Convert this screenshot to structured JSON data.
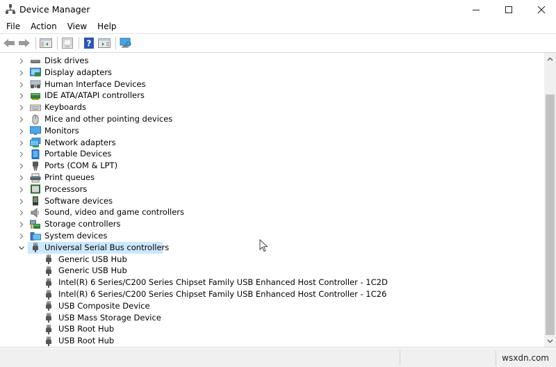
{
  "window": {
    "title": "Device Manager",
    "app_icon": "device-manager-icon",
    "controls": {
      "minimize": "–",
      "maximize": "☐",
      "close": "✕"
    }
  },
  "menu": [
    "File",
    "Action",
    "View",
    "Help"
  ],
  "toolbar": [
    {
      "name": "back-button",
      "icon": "arrow-left-icon"
    },
    {
      "name": "forward-button",
      "icon": "arrow-right-icon"
    },
    {
      "sep": true
    },
    {
      "name": "show-hide-console-tree-button",
      "icon": "console-tree-icon"
    },
    {
      "sep": true
    },
    {
      "name": "properties-button",
      "icon": "properties-icon"
    },
    {
      "sep": true
    },
    {
      "name": "help-button",
      "icon": "help-icon"
    },
    {
      "name": "show-action-pane-button",
      "icon": "action-pane-icon"
    },
    {
      "sep": true
    },
    {
      "name": "scan-hardware-button",
      "icon": "monitor-scan-icon"
    }
  ],
  "tree": {
    "categories": [
      {
        "label": "Disk drives",
        "icon": "disk-drive-icon",
        "expanded": false
      },
      {
        "label": "Display adapters",
        "icon": "display-adapter-icon",
        "expanded": false
      },
      {
        "label": "Human Interface Devices",
        "icon": "hid-icon",
        "expanded": false
      },
      {
        "label": "IDE ATA/ATAPI controllers",
        "icon": "ide-controller-icon",
        "expanded": false
      },
      {
        "label": "Keyboards",
        "icon": "keyboard-icon",
        "expanded": false
      },
      {
        "label": "Mice and other pointing devices",
        "icon": "mouse-icon",
        "expanded": false
      },
      {
        "label": "Monitors",
        "icon": "monitor-icon",
        "expanded": false
      },
      {
        "label": "Network adapters",
        "icon": "network-adapter-icon",
        "expanded": false
      },
      {
        "label": "Portable Devices",
        "icon": "portable-device-icon",
        "expanded": false
      },
      {
        "label": "Ports (COM & LPT)",
        "icon": "port-icon",
        "expanded": false
      },
      {
        "label": "Print queues",
        "icon": "printer-icon",
        "expanded": false
      },
      {
        "label": "Processors",
        "icon": "processor-icon",
        "expanded": false
      },
      {
        "label": "Software devices",
        "icon": "software-device-icon",
        "expanded": false
      },
      {
        "label": "Sound, video and game controllers",
        "icon": "speaker-icon",
        "expanded": false
      },
      {
        "label": "Storage controllers",
        "icon": "storage-controller-icon",
        "expanded": false
      },
      {
        "label": "System devices",
        "icon": "system-device-icon",
        "expanded": false
      },
      {
        "label": "Universal Serial Bus controllers",
        "icon": "usb-icon",
        "expanded": true,
        "selected": true
      }
    ],
    "usb_children": [
      "Generic USB Hub",
      "Generic USB Hub",
      "Intel(R) 6 Series/C200 Series Chipset Family USB Enhanced Host Controller - 1C2D",
      "Intel(R) 6 Series/C200 Series Chipset Family USB Enhanced Host Controller - 1C26",
      "USB Composite Device",
      "USB Mass Storage Device",
      "USB Root Hub",
      "USB Root Hub"
    ]
  },
  "scrollbar": {
    "up": "˄",
    "down": "˅",
    "position_fraction": 1.0
  },
  "statusbar": {
    "watermark": "wsxdn.com"
  },
  "colors": {
    "selection": "#cce8ff",
    "accent": "#0078d7"
  }
}
